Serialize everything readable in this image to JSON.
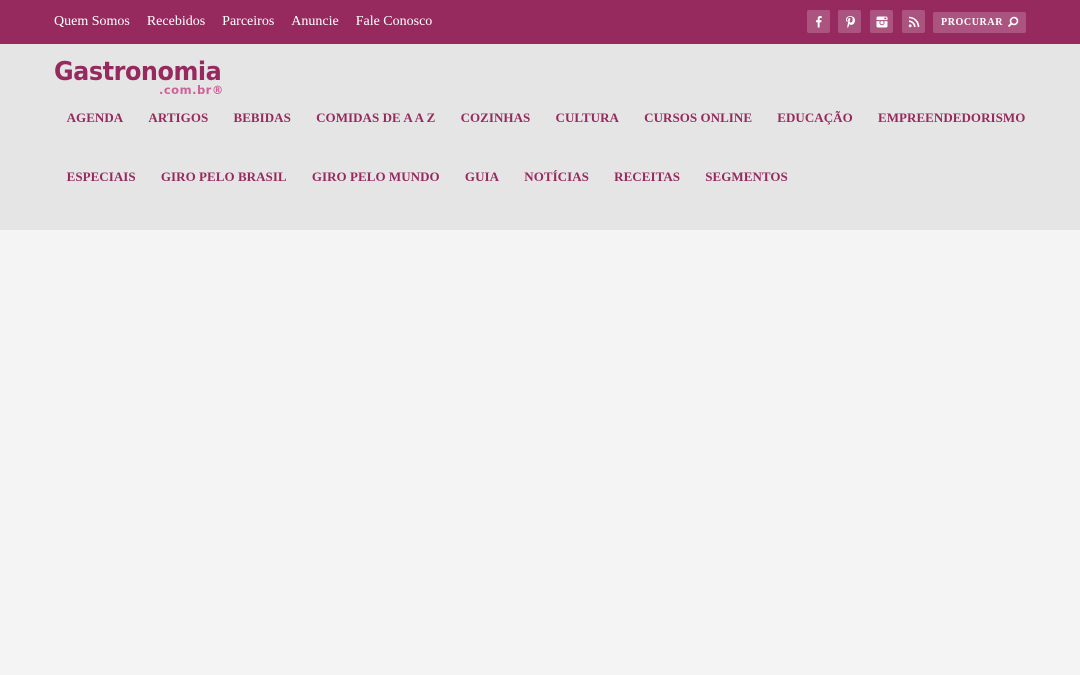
{
  "top_bar": {
    "links": [
      "Quem Somos",
      "Recebidos",
      "Parceiros",
      "Anuncie",
      "Fale Conosco"
    ],
    "social": [
      "facebook-icon",
      "pinterest-icon",
      "instagram-icon",
      "rss-icon"
    ],
    "search_label": "PROCURAR"
  },
  "logo": {
    "main": "Gastronomia",
    "sub": ".com.br®"
  },
  "nav": {
    "row1": [
      "AGENDA",
      "ARTIGOS",
      "BEBIDAS",
      "COMIDAS DE A A Z",
      "COZINHAS",
      "CULTURA",
      "CURSOS ONLINE",
      "EDUCAÇÃO",
      "EMPREENDEDORISMO"
    ],
    "row2": [
      "ESPECIAIS",
      "GIRO PELO BRASIL",
      "GIRO PELO MUNDO",
      "GUIA",
      "NOTÍCIAS",
      "RECEITAS",
      "SEGMENTOS"
    ]
  },
  "colors": {
    "brand": "#962a5f",
    "header_bg": "#e5e5e5",
    "page_bg": "#f4f4f4",
    "logo_sub": "#d1609a"
  }
}
